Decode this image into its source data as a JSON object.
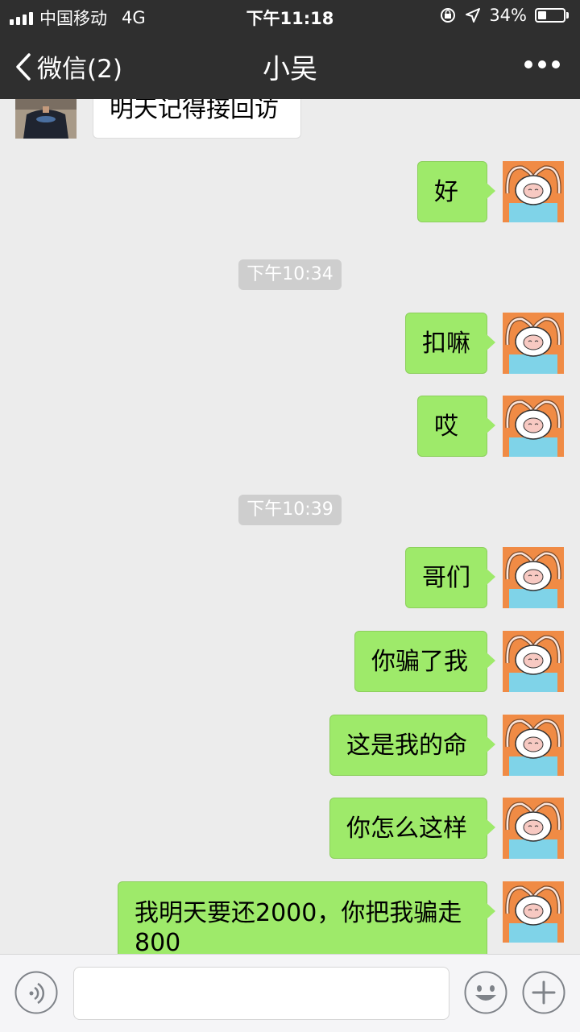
{
  "status_bar": {
    "carrier": "中国移动",
    "network": "4G",
    "time": "下午11:18",
    "battery_percent": "34%",
    "battery_level": 0.34
  },
  "nav": {
    "back_label": "微信(2)",
    "title": "小吴"
  },
  "messages": {
    "m0": "明天记得接回访",
    "m1": "好",
    "ts1": "下午10:34",
    "m2": "扣嘛",
    "m3": "哎",
    "ts2": "下午10:39",
    "m4": "哥们",
    "m5": "你骗了我",
    "m6": "这是我的命",
    "m7": "你怎么这样",
    "m8": "我明天要还2000，你把我骗走800"
  },
  "input": {
    "value": "",
    "placeholder": ""
  },
  "icons": {
    "back": "chevron-left-icon",
    "more": "more-dots-icon",
    "voice": "voice-icon",
    "emoji": "emoji-icon",
    "add": "plus-icon"
  },
  "colors": {
    "header": "#2f2f2f",
    "chat_bg": "#ececec",
    "bubble_out": "#9eea6a",
    "bubble_in": "#ffffff",
    "timestamp_bg": "#cecece"
  }
}
